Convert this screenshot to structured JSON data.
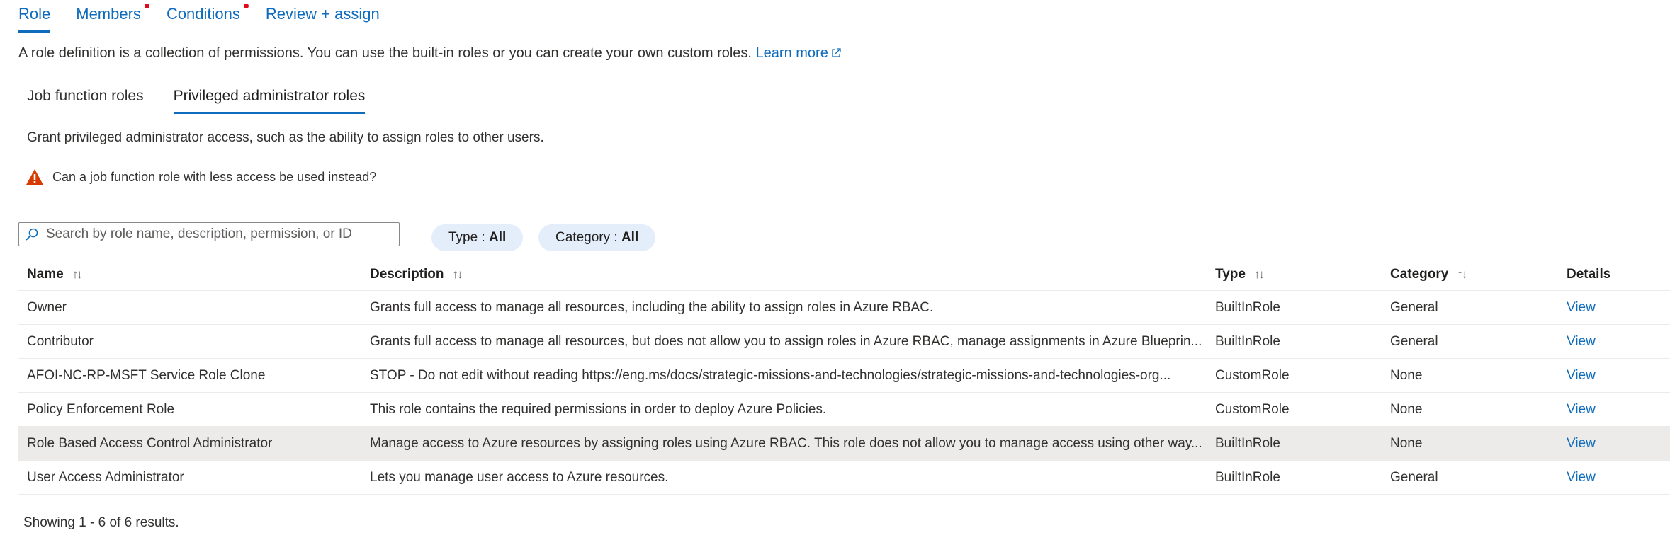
{
  "tabs": [
    {
      "label": "Role",
      "active": true,
      "dot": false
    },
    {
      "label": "Members",
      "active": false,
      "dot": true
    },
    {
      "label": "Conditions",
      "active": false,
      "dot": true
    },
    {
      "label": "Review + assign",
      "active": false,
      "dot": false
    }
  ],
  "intro": {
    "text": "A role definition is a collection of permissions. You can use the built-in roles or you can create your own custom roles.",
    "link": "Learn more"
  },
  "subtabs": [
    {
      "label": "Job function roles",
      "active": false
    },
    {
      "label": "Privileged administrator roles",
      "active": true
    }
  ],
  "grant_text": "Grant privileged administrator access, such as the ability to assign roles to other users.",
  "warning_text": "Can a job function role with less access be used instead?",
  "search": {
    "placeholder": "Search by role name, description, permission, or ID",
    "value": ""
  },
  "filters": {
    "type_label": "Type : ",
    "type_value": "All",
    "category_label": "Category : ",
    "category_value": "All"
  },
  "columns": {
    "name": "Name",
    "description": "Description",
    "type": "Type",
    "category": "Category",
    "details": "Details"
  },
  "sort_glyph": "↑↓",
  "rows": [
    {
      "name": "Owner",
      "description": "Grants full access to manage all resources, including the ability to assign roles in Azure RBAC.",
      "type": "BuiltInRole",
      "category": "General",
      "details": "View"
    },
    {
      "name": "Contributor",
      "description": "Grants full access to manage all resources, but does not allow you to assign roles in Azure RBAC, manage assignments in Azure Blueprin...",
      "type": "BuiltInRole",
      "category": "General",
      "details": "View"
    },
    {
      "name": "AFOI-NC-RP-MSFT Service Role Clone",
      "description": "STOP - Do not edit without reading https://eng.ms/docs/strategic-missions-and-technologies/strategic-missions-and-technologies-org...",
      "type": "CustomRole",
      "category": "None",
      "details": "View"
    },
    {
      "name": "Policy Enforcement Role",
      "description": "This role contains the required permissions in order to deploy Azure Policies.",
      "type": "CustomRole",
      "category": "None",
      "details": "View"
    },
    {
      "name": "Role Based Access Control Administrator",
      "description": "Manage access to Azure resources by assigning roles using Azure RBAC. This role does not allow you to manage access using other way...",
      "type": "BuiltInRole",
      "category": "None",
      "details": "View"
    },
    {
      "name": "User Access Administrator",
      "description": "Lets you manage user access to Azure resources.",
      "type": "BuiltInRole",
      "category": "General",
      "details": "View"
    }
  ],
  "footer": "Showing 1 - 6 of 6 results.",
  "colors": {
    "accent": "#0f6cbd",
    "warning": "#d83b01",
    "dot": "#e00b1c",
    "pill_bg": "#e3eefa",
    "selected_row": "#edebe9"
  }
}
